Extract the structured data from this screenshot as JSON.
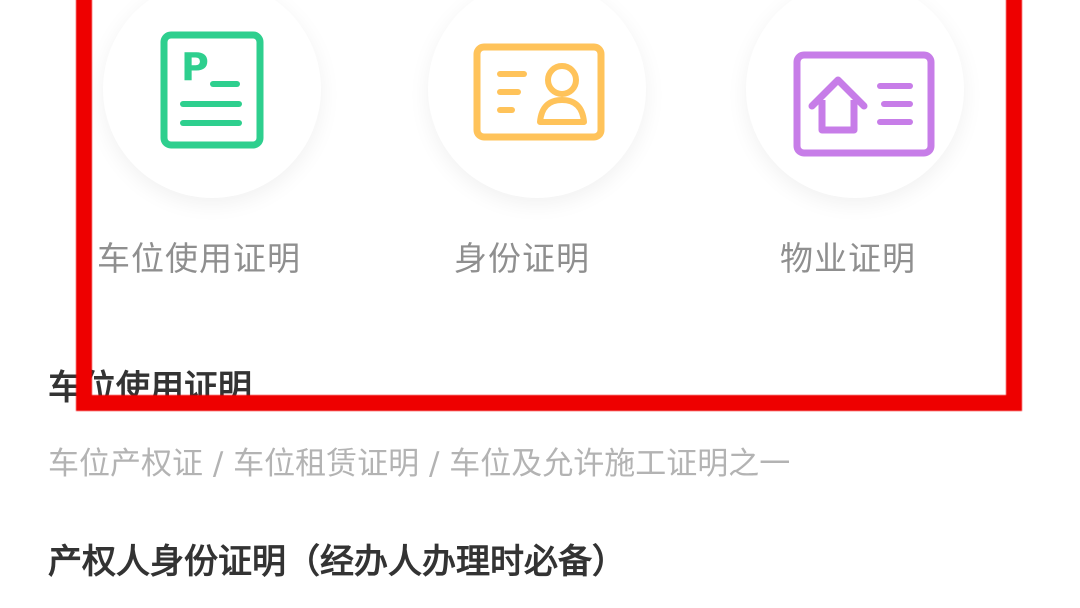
{
  "categories": [
    {
      "label": "车位使用证明",
      "icon": "parking-document-icon",
      "color": "#2ecf8e"
    },
    {
      "label": "身份证明",
      "icon": "id-card-icon",
      "color": "#ffc35a"
    },
    {
      "label": "物业证明",
      "icon": "property-house-icon",
      "color": "#c77de8"
    }
  ],
  "sections": [
    {
      "title": "车位使用证明",
      "subtitle": "车位产权证 / 车位租赁证明 / 车位及允许施工证明之一"
    },
    {
      "title": "产权人身份证明（经办人办理时必备）"
    }
  ],
  "highlight": {
    "color": "#ee0000"
  }
}
